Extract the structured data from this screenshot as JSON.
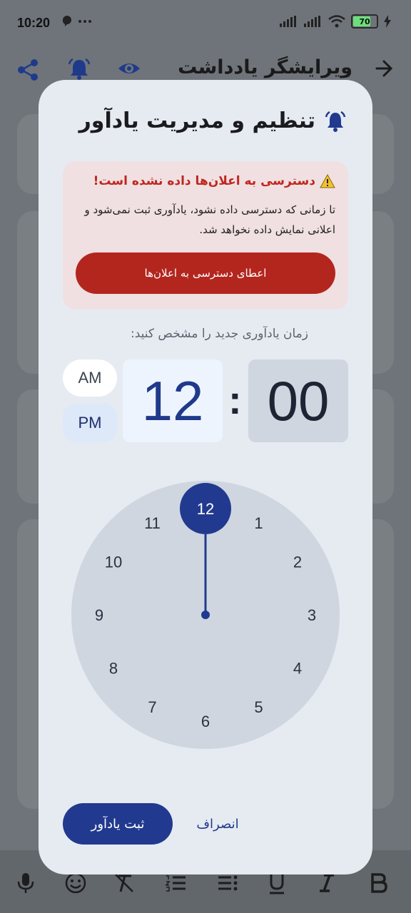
{
  "status_bar": {
    "time": "10:20",
    "battery": "70",
    "dots": "···"
  },
  "app_bar": {
    "title": "ویرایشگر یادداشت"
  },
  "dialog": {
    "title": "تنظیم و مدیریت یادآور",
    "warning": {
      "title": "دسترسی به اعلان‌ها داده نشده است!",
      "body": "تا زمانی که دسترسی داده نشود، یادآوری ثبت نمی‌شود و اعلانی نمایش داده نخواهد شد.",
      "grant_button": "اعطای دسترسی به اعلان‌ها"
    },
    "prompt": "زمان یادآوری جدید را مشخص کنید:",
    "time_picker": {
      "am_label": "AM",
      "pm_label": "PM",
      "selected_period": "PM",
      "hour": "12",
      "separator": ":",
      "minute": "00"
    },
    "clock_face": {
      "numbers": [
        "12",
        "1",
        "2",
        "3",
        "4",
        "5",
        "6",
        "7",
        "8",
        "9",
        "10",
        "11"
      ],
      "selected": "12"
    },
    "buttons": {
      "cancel": "انصراف",
      "save": "ثبت یادآور"
    }
  },
  "colors": {
    "accent": "#213a8f",
    "error": "#b3261e",
    "dialog_bg": "#e6ebf2"
  }
}
